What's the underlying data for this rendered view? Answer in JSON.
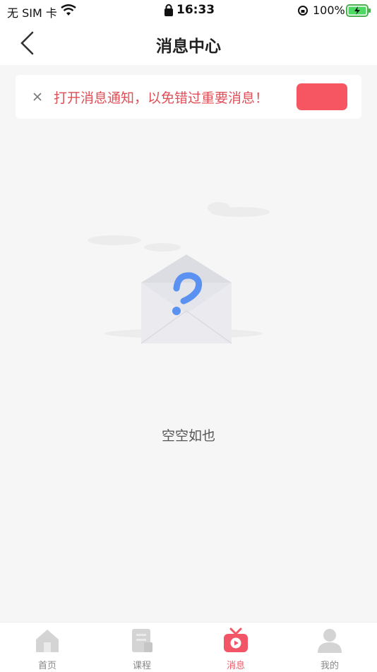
{
  "status_bar": {
    "carrier": "无 SIM 卡",
    "time": "16:33",
    "battery": "100%"
  },
  "nav": {
    "title": "消息中心"
  },
  "notice": {
    "text": "打开消息通知，以免错过重要消息！",
    "action_label": "",
    "accent_color": "#f55662"
  },
  "empty_state": {
    "text": "空空如也"
  },
  "tab_bar": {
    "tabs": [
      {
        "label": "首页",
        "icon": "home-icon",
        "active": false
      },
      {
        "label": "课程",
        "icon": "course-icon",
        "active": false
      },
      {
        "label": "消息",
        "icon": "message-tv-icon",
        "active": true
      },
      {
        "label": "我的",
        "icon": "profile-icon",
        "active": false
      }
    ],
    "active_color": "#f25565"
  }
}
